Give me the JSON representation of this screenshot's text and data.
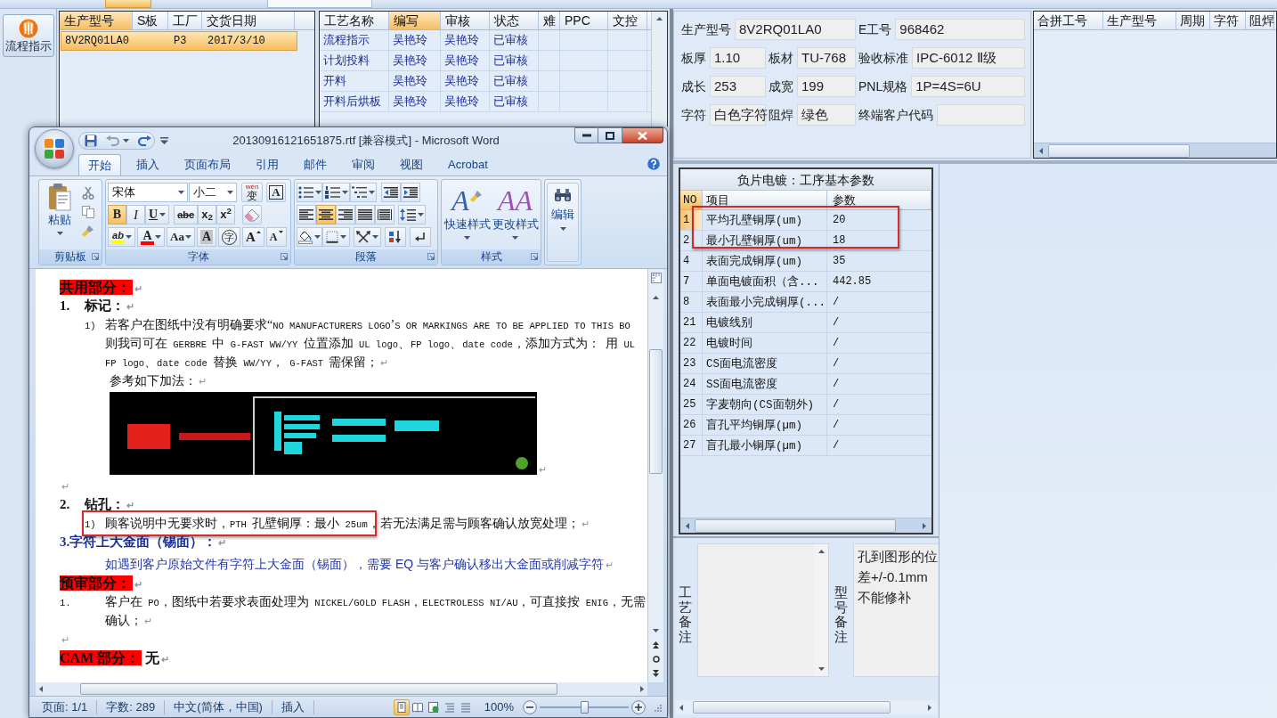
{
  "sidebar": {
    "buttons": [
      {
        "label": "流程指示"
      }
    ]
  },
  "orders": {
    "columns": [
      {
        "label": "生产型号",
        "selected": true
      },
      {
        "label": "S板",
        "selected": false
      },
      {
        "label": "工厂",
        "selected": false
      },
      {
        "label": "交货日期",
        "selected": false
      }
    ],
    "rows": [
      {
        "model": "8V2RQ01LA0",
        "factory": "P3",
        "delivery_date": "2017/3/10",
        "selected": true
      }
    ]
  },
  "processes": {
    "columns": [
      {
        "label": "工艺名称",
        "selected": false
      },
      {
        "label": "编写",
        "selected": true
      },
      {
        "label": "审核",
        "selected": false
      },
      {
        "label": "状态",
        "selected": false
      },
      {
        "label": "难",
        "selected": false
      },
      {
        "label": "PPC",
        "selected": false
      },
      {
        "label": "文控",
        "selected": false
      }
    ],
    "rows": [
      {
        "name": "流程指示",
        "author": "吴艳玲",
        "reviewer": "吴艳玲",
        "status": "已审核"
      },
      {
        "name": "计划投料",
        "author": "吴艳玲",
        "reviewer": "吴艳玲",
        "status": "已审核"
      },
      {
        "name": "开料",
        "author": "吴艳玲",
        "reviewer": "吴艳玲",
        "status": "已审核"
      },
      {
        "name": "开料后烘板",
        "author": "吴艳玲",
        "reviewer": "吴艳玲",
        "status": "已审核"
      }
    ]
  },
  "info": {
    "rows": [
      [
        {
          "label": "生产型号",
          "value": "8V2RQ01LA0",
          "colspan": 2
        },
        {
          "label": "E工号",
          "value": "968462"
        }
      ],
      [
        {
          "label": "板厚",
          "value": "1.10"
        },
        {
          "label": "板材",
          "value": "TU-768"
        },
        {
          "label": "验收标准",
          "value": "IPC-6012 Ⅱ级"
        }
      ],
      [
        {
          "label": "成长",
          "value": "253"
        },
        {
          "label": "成宽",
          "value": "199"
        },
        {
          "label": "PNL规格",
          "value": "1P=4S=6U"
        }
      ],
      [
        {
          "label": "字符",
          "value": "白色字符"
        },
        {
          "label": "阻焊",
          "value": "绿色"
        },
        {
          "label": "终端客户代码"
        }
      ]
    ]
  },
  "merge_table": {
    "columns": [
      "合拼工号",
      "生产型号",
      "周期",
      "字符",
      "阻焊"
    ]
  },
  "params": {
    "title": "负片电镀：工序基本参数",
    "columns": [
      {
        "label": "NO",
        "selected": true
      },
      {
        "label": "项目",
        "selected": false
      },
      {
        "label": "参数",
        "selected": false
      }
    ],
    "rows": [
      {
        "no": "1",
        "item": "平均孔壁铜厚(um)",
        "value": "20",
        "selected": true,
        "marked": true
      },
      {
        "no": "2",
        "item": "最小孔壁铜厚(um)",
        "value": "18",
        "selected": false,
        "marked": true
      },
      {
        "no": "4",
        "item": "表面完成铜厚(um)",
        "value": "35",
        "selected": false,
        "marked": false
      },
      {
        "no": "7",
        "item": "单面电镀面积（含...",
        "value": "442.85",
        "selected": false,
        "marked": false
      },
      {
        "no": "8",
        "item": "表面最小完成铜厚(...",
        "value": "/",
        "selected": false,
        "marked": false
      },
      {
        "no": "21",
        "item": "电镀线别",
        "value": "/",
        "selected": false,
        "marked": false
      },
      {
        "no": "22",
        "item": "电镀时间",
        "value": "/",
        "selected": false,
        "marked": false
      },
      {
        "no": "23",
        "item": "CS面电流密度",
        "value": "/",
        "selected": false,
        "marked": false
      },
      {
        "no": "24",
        "item": "SS面电流密度",
        "value": "/",
        "selected": false,
        "marked": false
      },
      {
        "no": "25",
        "item": "字麦朝向(CS面朝外)",
        "value": "/",
        "selected": false,
        "marked": false
      },
      {
        "no": "26",
        "item": "盲孔平均铜厚(μm)",
        "value": "/",
        "selected": false,
        "marked": false
      },
      {
        "no": "27",
        "item": "盲孔最小铜厚(μm)",
        "value": "/",
        "selected": false,
        "marked": false
      }
    ]
  },
  "notes": {
    "process_label": "工艺备注",
    "model_label": "型号备注",
    "model_note": [
      "孔到图形的位",
      "差+/-0.1mm",
      "不能修补"
    ]
  },
  "word": {
    "title": "20130916121651875.rtf [兼容模式] - Microsoft Word",
    "tabs": [
      {
        "label": "开始",
        "selected": true
      },
      {
        "label": "插入",
        "selected": false
      },
      {
        "label": "页面布局",
        "selected": false
      },
      {
        "label": "引用",
        "selected": false
      },
      {
        "label": "邮件",
        "selected": false
      },
      {
        "label": "审阅",
        "selected": false
      },
      {
        "label": "视图",
        "selected": false
      },
      {
        "label": "Acrobat",
        "selected": false
      }
    ],
    "clipboard": {
      "label": "剪贴板",
      "paste": "粘贴"
    },
    "font": {
      "label": "字体",
      "name": "宋体",
      "size": "小二",
      "phonetic": {
        "reading": "wén",
        "glyph": "变"
      },
      "border_glyph": "A",
      "format_buttons": [
        {
          "kind": "bold",
          "glyph": "B",
          "on": true
        },
        {
          "kind": "italic",
          "glyph": "I",
          "on": false
        },
        {
          "kind": "underline",
          "glyph": "U",
          "on": false
        },
        {
          "kind": "strike",
          "glyph": "abc",
          "on": false
        },
        {
          "kind": "subscript",
          "glyph": "x$_{2}$",
          "on": false
        },
        {
          "kind": "superscript",
          "glyph": "x$^{2}$",
          "on": false
        }
      ],
      "effect_buttons": [
        {
          "kind": "highlight",
          "glyph": "ab",
          "color": "#ffff00"
        },
        {
          "kind": "font-color",
          "glyph": "A",
          "color": "#ff0000"
        },
        {
          "kind": "case",
          "glyph": "Aa"
        },
        {
          "kind": "shading",
          "glyph": "A"
        },
        {
          "kind": "enclose",
          "glyph": "字"
        },
        {
          "kind": "grow",
          "glyph": "A"
        },
        {
          "kind": "shrink",
          "glyph": "A"
        }
      ]
    },
    "paragraph": {
      "label": "段落",
      "alignment": [
        {
          "kind": "left",
          "selected": false
        },
        {
          "kind": "center",
          "selected": true
        },
        {
          "kind": "right",
          "selected": false
        },
        {
          "kind": "justify",
          "selected": false
        },
        {
          "kind": "distribute",
          "selected": false
        }
      ]
    },
    "styles": {
      "label": "样式",
      "buttons": [
        {
          "kind": "quick",
          "glyph": "A",
          "label": "快速样式"
        },
        {
          "kind": "change",
          "glyph": "AA",
          "label": "更改样式"
        }
      ]
    },
    "editing": {
      "label": "编辑"
    },
    "document": {
      "blocks": [
        {
          "kind": "section",
          "text": "共用部分：",
          "end": "↵"
        },
        {
          "kind": "numbered",
          "number": "1.",
          "text": "标记：",
          "end": "↵"
        },
        {
          "kind": "item",
          "number": "1)",
          "lines": [
            "若客户在图纸中没有明确要求“NO MANUFACTURERS LOGO’S OR MARKINGS ARE TO BE APPLIED TO THIS BO",
            "则我司可在 GERBRE 中 G-FAST WW/YY 位置添加 UL logo、FP logo、date code，添加方式为： 用 UL",
            "FP logo、date code 替换 WW/YY， G-FAST 需保留；"
          ],
          "end": "↵",
          "marked": false
        },
        {
          "kind": "plain",
          "text": "参考如下加法：",
          "end": "↵"
        },
        {
          "kind": "image",
          "end": "↵"
        },
        {
          "kind": "blank",
          "end": "↵"
        },
        {
          "kind": "numbered",
          "number": "2.",
          "text": "钻孔：",
          "end": "↵"
        },
        {
          "kind": "item",
          "number": "1)",
          "lines": [
            "顾客说明中无要求时，PTH 孔壁铜厚：最小 25um，若无法满足需与顾客确认放宽处理；"
          ],
          "end": "↵",
          "marked": true
        },
        {
          "kind": "heading",
          "text": "3.字符上大金面（锡面）：",
          "end": "↵"
        },
        {
          "kind": "note",
          "text": "如遇到客户原始文件有字符上大金面（锡面），需要 EQ 与客户确认移出大金面或削减字符",
          "end": "↵"
        },
        {
          "kind": "section",
          "text": "预审部分：",
          "end": "↵"
        },
        {
          "kind": "list",
          "number": "1.",
          "lines": [
            "客户在 PO，图纸中若要求表面处理为 NICKEL/GOLD FLASH，ELECTROLESS NI/AU，可直接按 ENIG，无需",
            "确认；"
          ],
          "end": "↵"
        },
        {
          "kind": "blank",
          "end": "↵"
        },
        {
          "kind": "section",
          "text": "CAM 部分：",
          "after": "无",
          "end": "↵"
        }
      ]
    },
    "status_bar": {
      "page": "页面: 1/1",
      "words": "字数: 289",
      "language": "中文(简体，中国)",
      "mode": "插入",
      "views": [
        {
          "kind": "print",
          "selected": true
        },
        {
          "kind": "reading",
          "selected": false
        },
        {
          "kind": "web",
          "selected": false
        },
        {
          "kind": "outline",
          "selected": false
        },
        {
          "kind": "draft",
          "selected": false
        }
      ],
      "zoom": "100%",
      "zoom_slider": {
        "level": 0.5
      }
    }
  }
}
